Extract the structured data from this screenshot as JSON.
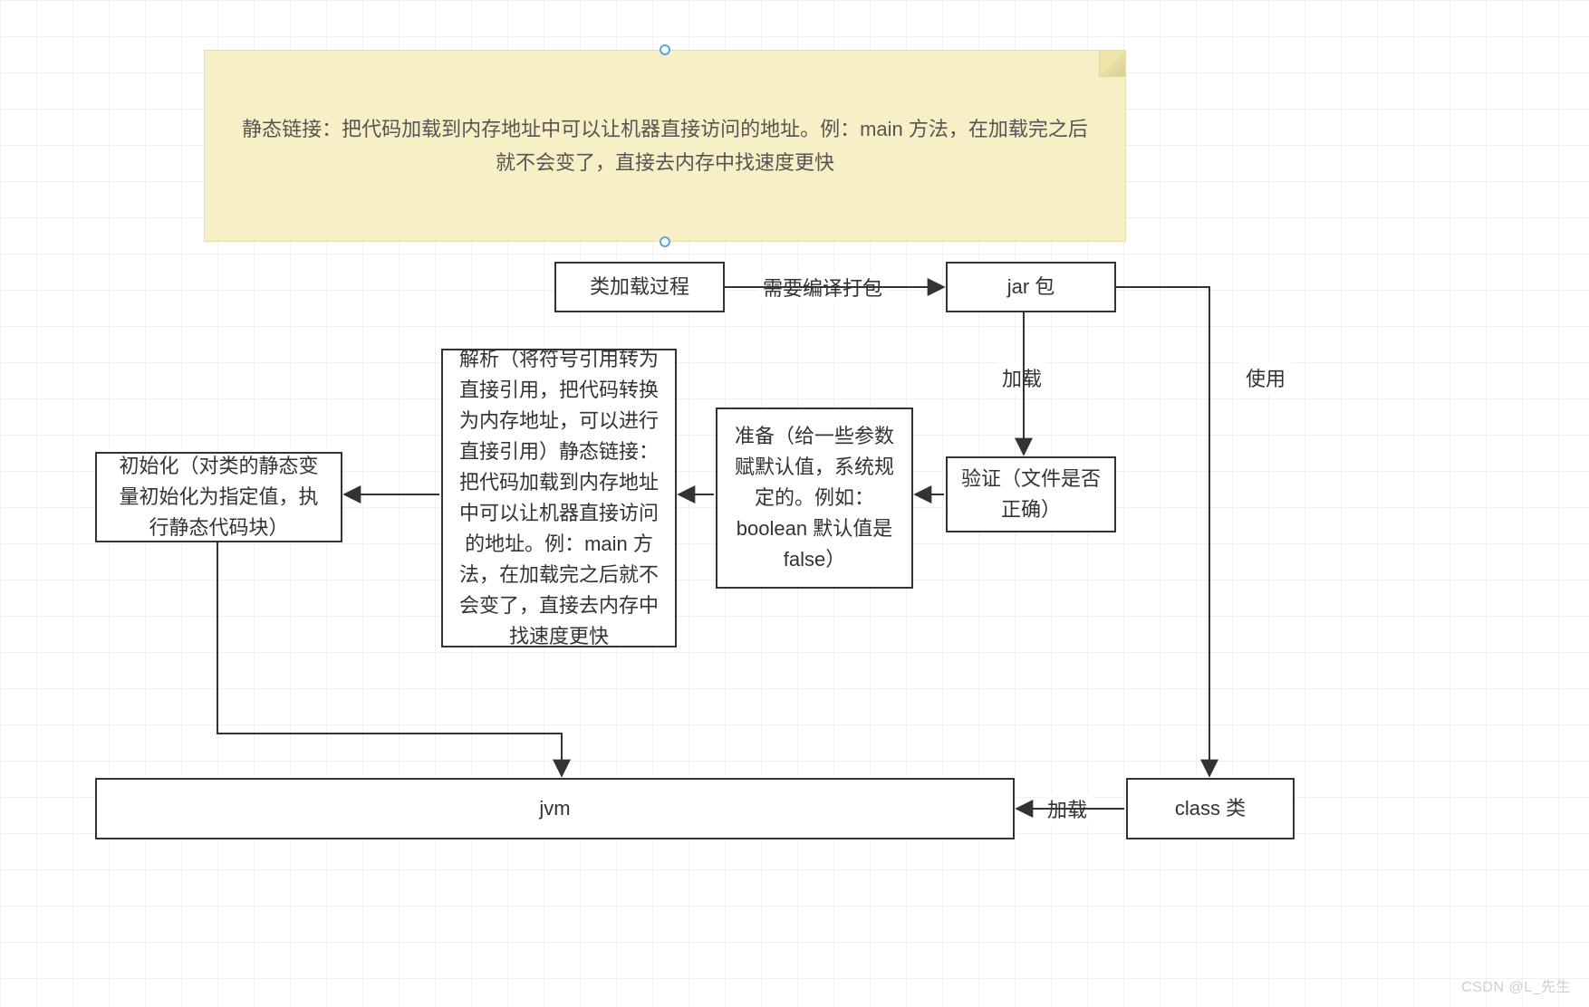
{
  "note": {
    "text": "静态链接：把代码加载到内存地址中可以让机器直接访问的地址。例：main 方法，在加载完之后就不会变了，直接去内存中找速度更快"
  },
  "boxes": {
    "class_loading": "类加载过程",
    "jar": "jar 包",
    "verify": "验证（文件是否正确）",
    "prepare": "准备（给一些参数赋默认值，系统规定的。例如：boolean 默认值是 false）",
    "resolve": "解析（将符号引用转为直接引用，把代码转换为内存地址，可以进行直接引用）静态链接：把代码加载到内存地址中可以让机器直接访问的地址。例：main 方法，在加载完之后就不会变了，直接去内存中找速度更快",
    "init": "初始化（对类的静态变量初始化为指定值，执行静态代码块）",
    "jvm": "jvm",
    "class": "class 类"
  },
  "edges": {
    "compile_pack": "需要编译打包",
    "load1": "加载",
    "use": "使用",
    "load2": "加载"
  },
  "watermark": "CSDN @L_先生"
}
